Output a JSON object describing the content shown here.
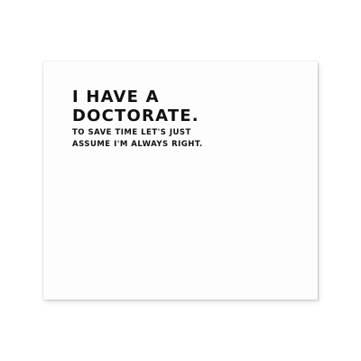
{
  "card": {
    "headline_line1": "I HAVE A",
    "headline_line2": "DOCTORATE.",
    "body_line1": "TO SAVE TIME LET'S JUST",
    "body_line2": "ASSUME I'M ALWAYS RIGHT."
  },
  "colors": {
    "background": "#ffffff",
    "card": "#fdfdfd",
    "text": "#111111"
  }
}
